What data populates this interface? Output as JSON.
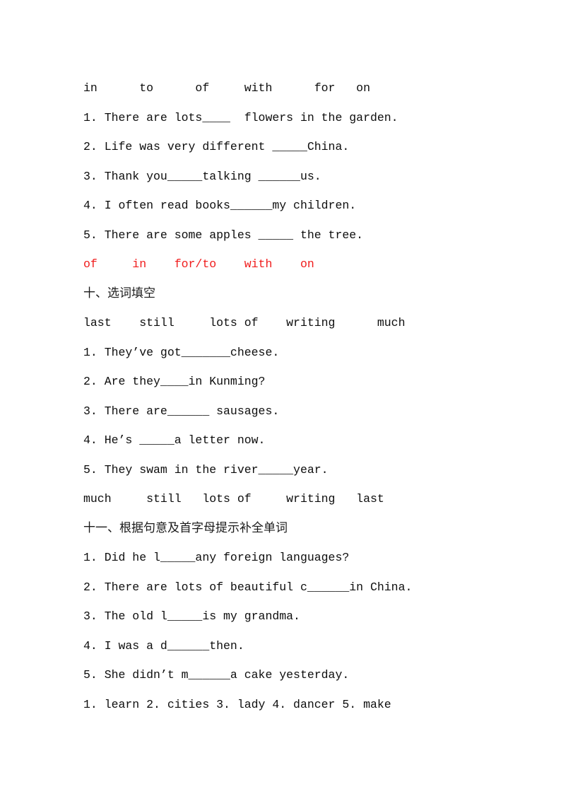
{
  "document": {
    "background_color": "#ffffff",
    "text_color": "#0d0d0d",
    "answer_highlight_color": "#f01c1c"
  },
  "exercise_nine": {
    "word_bank": "in      to      of     with      for   on",
    "questions": [
      "1. There are lots____  flowers in the garden.",
      "2. Life was very different _____China.",
      "3. Thank you_____talking ______us.",
      "4. I often read books______my children.",
      "5. There are some apples _____ the tree."
    ],
    "answers": "of     in    for/to    with    on"
  },
  "exercise_ten": {
    "heading": "十、选词填空",
    "word_bank": "last    still     lots of    writing      much",
    "questions": [
      "1. They’ve got_______cheese.",
      "2. Are they____in Kunming?",
      "3. There are______ sausages.",
      "4. He’s _____a letter now.",
      "5. They swam in the river_____year."
    ],
    "answers": "much     still   lots of     writing   last"
  },
  "exercise_eleven": {
    "heading": "十一、根据句意及首字母提示补全单词",
    "questions": [
      "1. Did he l_____any foreign languages?",
      "2. There are lots of beautiful c______in China.",
      "3. The old l_____is my grandma.",
      "4. I was a d______then.",
      "5. She didn’t m______a cake yesterday."
    ],
    "answers": "1. learn 2. cities 3. lady 4. dancer 5. make"
  }
}
